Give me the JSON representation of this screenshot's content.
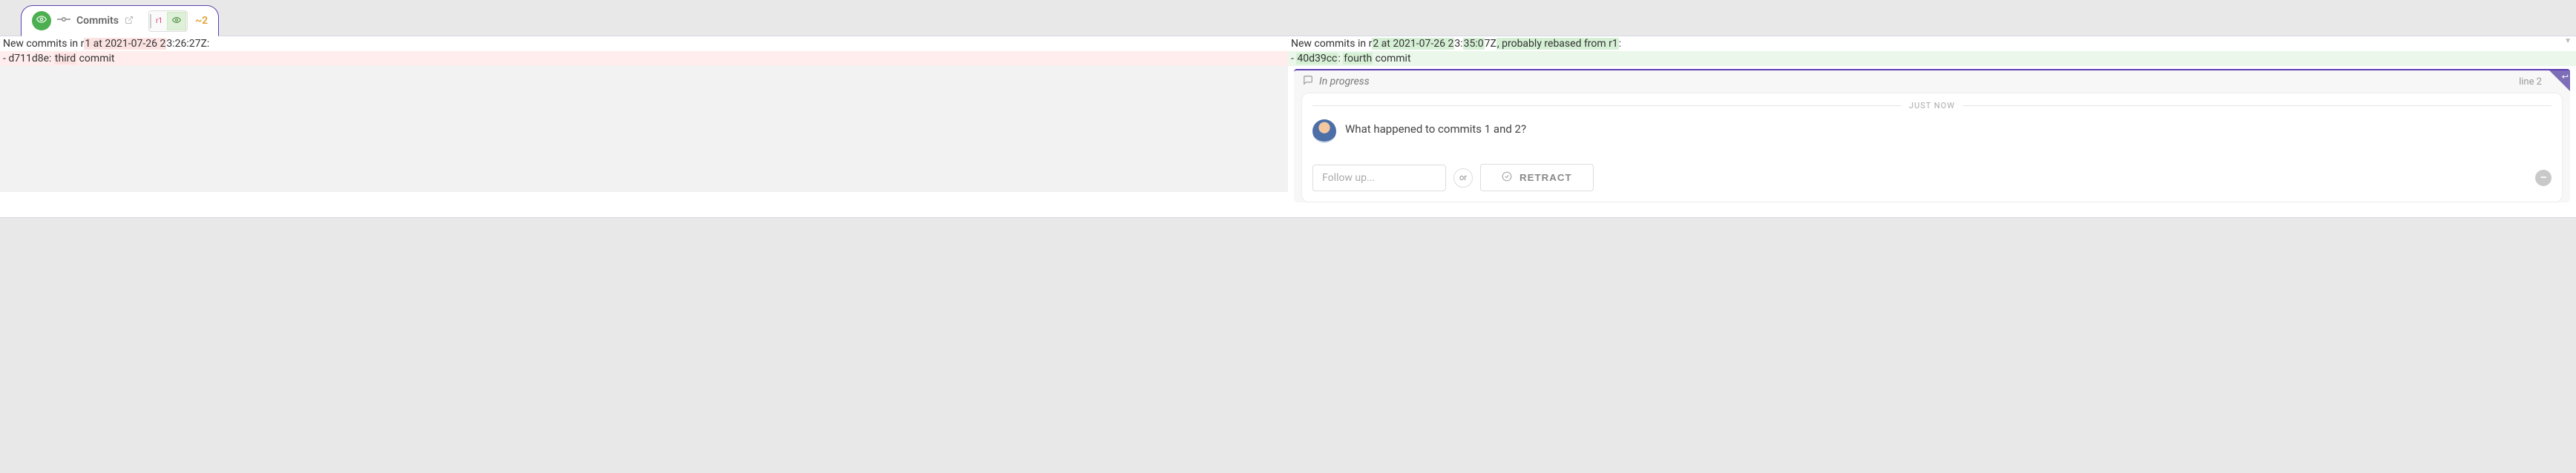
{
  "tab": {
    "label": "Commits",
    "chip_rev": "r1",
    "delta": "~2"
  },
  "left": {
    "header": {
      "a": "New commits in r",
      "b": "1 at 2021-07-26 2",
      "c": "3:26:27Z:"
    },
    "line2": {
      "a": "- d711d8e: ",
      "b": "third",
      "c": " commit"
    }
  },
  "right": {
    "header": {
      "a": "New commits in r",
      "b": "2 at 2021-07-26 2",
      "c": "3:",
      "d": "35:0",
      "e": "7Z",
      "f": ", probably rebased from r1",
      "g": ":"
    },
    "line2": {
      "a": "- ",
      "b": "40d39cc",
      "c": ": ",
      "d": "fourth",
      "e": " commit"
    }
  },
  "thread": {
    "status": "In progress",
    "line_ref": "line 2",
    "time_label": "JUST NOW",
    "comment": "What happened to commits 1 and 2?",
    "followup_placeholder": "Follow up...",
    "or_label": "or",
    "retract_label": "RETRACT"
  }
}
